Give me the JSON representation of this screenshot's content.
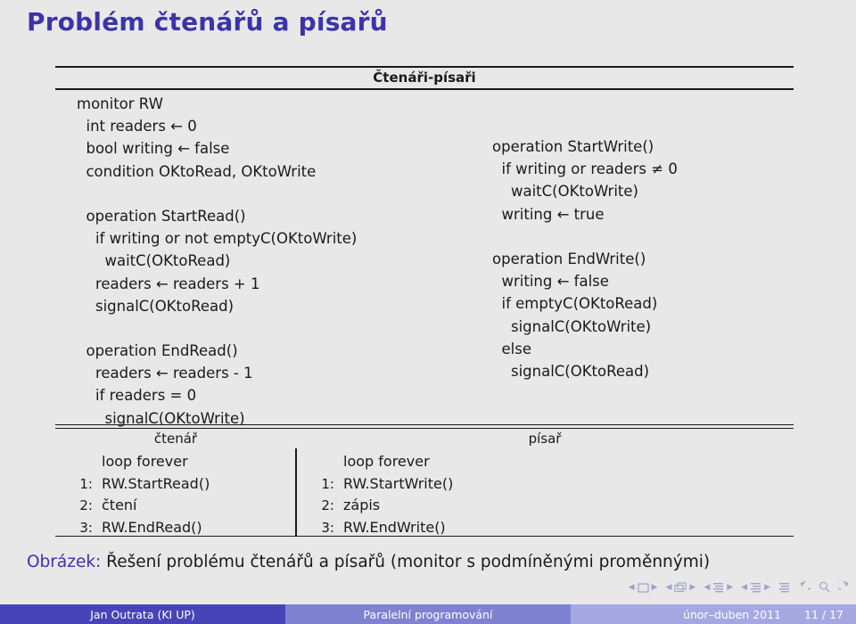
{
  "slide": {
    "title": "Problém čtenářů a písařů"
  },
  "figure": {
    "table_header": "Čtenáři-písaři",
    "monitor_code_left": [
      "monitor RW",
      "  int readers ← 0",
      "  bool writing ← false",
      "  condition OKtoRead, OKtoWrite",
      "",
      "  operation StartRead()",
      "    if writing or not emptyC(OKtoWrite)",
      "      waitC(OKtoRead)",
      "    readers ← readers + 1",
      "    signalC(OKtoRead)",
      "",
      "  operation EndRead()",
      "    readers ← readers - 1",
      "    if readers = 0",
      "      signalC(OKtoWrite)"
    ],
    "monitor_code_right": [
      "operation StartWrite()",
      "  if writing or readers ≠ 0",
      "    waitC(OKtoWrite)",
      "  writing ← true",
      "",
      "operation EndWrite()",
      "  writing ← false",
      "  if emptyC(OKtoRead)",
      "    signalC(OKtoWrite)",
      "  else",
      "    signalC(OKtoRead)"
    ],
    "processes": [
      {
        "name": "čtenář",
        "lines": [
          {
            "num": "",
            "code": "loop forever"
          },
          {
            "num": "1:",
            "code": "RW.StartRead()"
          },
          {
            "num": "2:",
            "code": "čtení"
          },
          {
            "num": "3:",
            "code": "RW.EndRead()"
          }
        ]
      },
      {
        "name": "písař",
        "lines": [
          {
            "num": "",
            "code": "loop forever"
          },
          {
            "num": "1:",
            "code": "RW.StartWrite()"
          },
          {
            "num": "2:",
            "code": "zápis"
          },
          {
            "num": "3:",
            "code": "RW.EndWrite()"
          }
        ]
      }
    ]
  },
  "caption": {
    "label": "Obrázek:",
    "text": " Řešení problému čtenářů a písařů (monitor s podmíněnými proměnnými)"
  },
  "footer": {
    "author": "Jan Outrata  (KI UP)",
    "subject": "Paralelní programování",
    "date": "únor–duben 2011",
    "page": "11 / 17"
  },
  "colors": {
    "title": "#3b34a8",
    "background": "#e8e8e8",
    "footer_left": "#4744b8",
    "footer_mid": "#7f82d0",
    "footer_right": "#a5a8e0"
  }
}
